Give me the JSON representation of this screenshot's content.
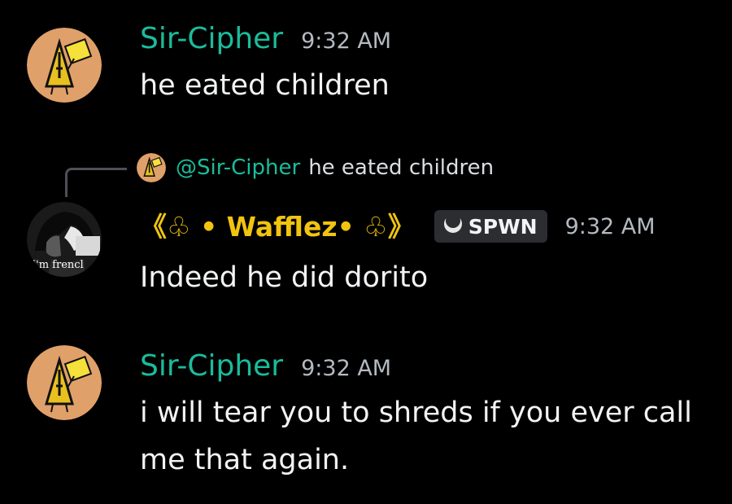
{
  "colors": {
    "cipher_name": "#1abc9c",
    "wafflez_name": "#f1c40f",
    "timestamp": "#b5bac1",
    "message_text": "#f2f3f5",
    "tag_bg": "#2b2d31",
    "background": "#000000"
  },
  "messages": [
    {
      "author": "Sir-Cipher",
      "timestamp": "9:32 AM",
      "content": "he eated children",
      "avatar_icon": "bill-cipher-avatar"
    },
    {
      "author": "《♧ • Wafflez• ♧》",
      "timestamp": "9:32 AM",
      "content": "Indeed he did dorito",
      "avatar_icon": "anime-character-avatar",
      "avatar_caption": "I'm frencl",
      "tag": {
        "icon": "moon-icon",
        "label": "SPWN"
      },
      "reply": {
        "mention": "@Sir-Cipher",
        "text": "he eated children",
        "avatar_icon": "bill-cipher-avatar"
      }
    },
    {
      "author": "Sir-Cipher",
      "timestamp": "9:32 AM",
      "content": "i will tear you to shreds if you ever call me that again.",
      "avatar_icon": "bill-cipher-avatar"
    }
  ]
}
